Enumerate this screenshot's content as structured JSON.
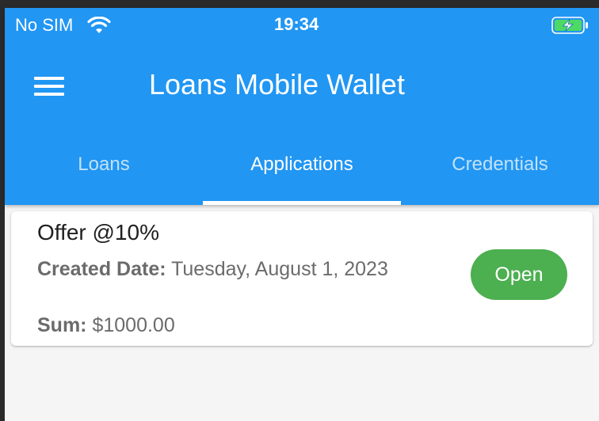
{
  "status_bar": {
    "carrier": "No SIM",
    "time": "19:34",
    "wifi_icon": "wifi-icon",
    "battery_icon": "battery-charging-icon"
  },
  "toolbar": {
    "menu_icon": "menu-icon",
    "title": "Loans Mobile Wallet"
  },
  "tabs": [
    {
      "label": "Loans",
      "active": false
    },
    {
      "label": "Applications",
      "active": true
    },
    {
      "label": "Credentials",
      "active": false
    }
  ],
  "applications": [
    {
      "title": "Offer @10%",
      "created_label": "Created Date:",
      "created_value": "Tuesday, August 1, 2023",
      "sum_label": "Sum:",
      "sum_value": "$1000.00",
      "status": "Open"
    }
  ],
  "colors": {
    "primary": "#2196f3",
    "status_open": "#4caf50",
    "battery_fill": "#4cd964",
    "background": "#f5f5f5"
  }
}
